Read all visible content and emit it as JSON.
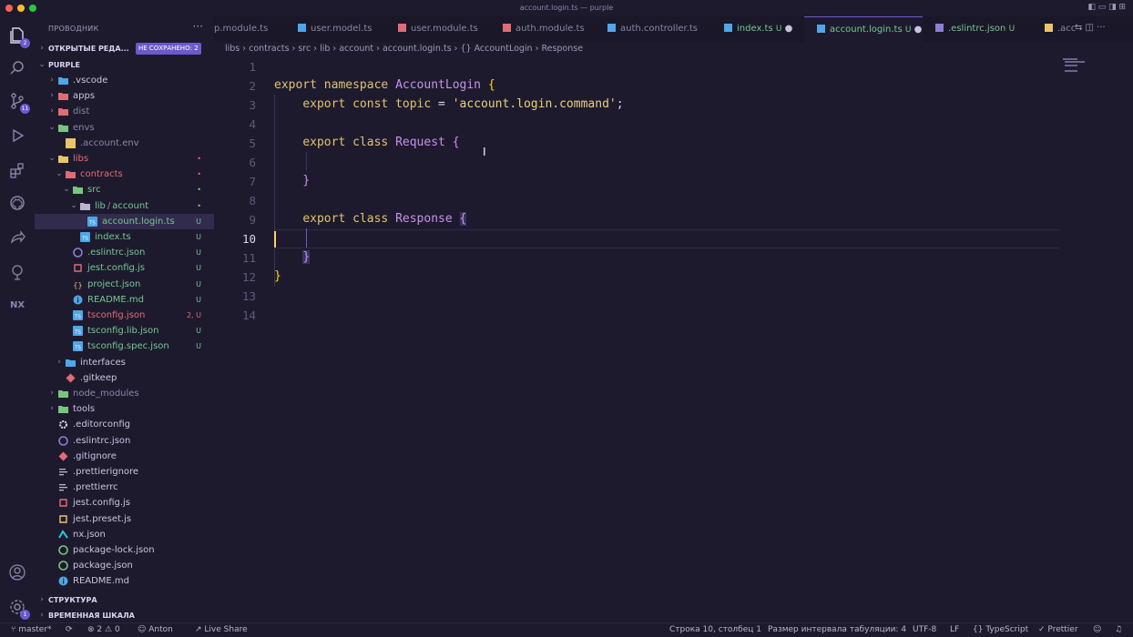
{
  "window": {
    "title": "account.login.ts — purple"
  },
  "colors": {
    "background": "#1e1a2e",
    "accent": "#6b5acd",
    "untracked": "#73c991",
    "error": "#e06c75",
    "keyword": "#e0c46c",
    "type": "#c792ea",
    "string": "#e8d27a"
  },
  "activity": {
    "explorer_badge": "2",
    "scm_badge": "11",
    "accounts_badge": "1",
    "nx_label": "NX"
  },
  "sidebar": {
    "title": "ПРОВОДНИК",
    "open_editors": "ОТКРЫТЫЕ РЕДА...",
    "unsaved_badge": "НЕ СОХРАНЕНО: 2",
    "root": "PURPLE",
    "outline": "СТРУКТУРА",
    "timeline": "ВРЕМЕННАЯ ШКАЛА",
    "tree": [
      {
        "label": ".vscode",
        "status": ""
      },
      {
        "label": "apps",
        "status": ""
      },
      {
        "label": "dist",
        "status": ""
      },
      {
        "label": "envs",
        "status": ""
      },
      {
        "label": ".account.env",
        "status": ""
      },
      {
        "label": "libs",
        "status": "•"
      },
      {
        "label": "contracts",
        "status": "•"
      },
      {
        "label": "src",
        "status": "•"
      },
      {
        "label": "lib",
        "sep": "/",
        "label2": "account",
        "status": "•"
      },
      {
        "label": "account.login.ts",
        "status": "U"
      },
      {
        "label": "index.ts",
        "status": "U"
      },
      {
        "label": ".eslintrc.json",
        "status": "U"
      },
      {
        "label": "jest.config.js",
        "status": "U"
      },
      {
        "label": "project.json",
        "status": "U"
      },
      {
        "label": "README.md",
        "status": "U"
      },
      {
        "label": "tsconfig.json",
        "status": "2, U"
      },
      {
        "label": "tsconfig.lib.json",
        "status": "U"
      },
      {
        "label": "tsconfig.spec.json",
        "status": "U"
      },
      {
        "label": "interfaces",
        "status": ""
      },
      {
        "label": ".gitkeep",
        "status": ""
      },
      {
        "label": "node_modules",
        "status": ""
      },
      {
        "label": "tools",
        "status": ""
      },
      {
        "label": ".editorconfig",
        "status": ""
      },
      {
        "label": ".eslintrc.json",
        "status": ""
      },
      {
        "label": ".gitignore",
        "status": ""
      },
      {
        "label": ".prettierignore",
        "status": ""
      },
      {
        "label": ".prettierrc",
        "status": ""
      },
      {
        "label": "jest.config.js",
        "status": ""
      },
      {
        "label": "jest.preset.js",
        "status": ""
      },
      {
        "label": "nx.json",
        "status": ""
      },
      {
        "label": "package-lock.json",
        "status": ""
      },
      {
        "label": "package.json",
        "status": ""
      },
      {
        "label": "README.md",
        "status": ""
      }
    ]
  },
  "tabs": [
    {
      "label": "p.module.ts",
      "status": ""
    },
    {
      "label": "user.model.ts",
      "status": ""
    },
    {
      "label": "user.module.ts",
      "status": ""
    },
    {
      "label": "auth.module.ts",
      "status": ""
    },
    {
      "label": "auth.controller.ts",
      "status": ""
    },
    {
      "label": "index.ts",
      "status": "U"
    },
    {
      "label": "account.login.ts",
      "status": "U"
    },
    {
      "label": ".eslintrc.json",
      "status": "U"
    },
    {
      "label": ".acc",
      "status": ""
    }
  ],
  "tab_icon_ts": "TS",
  "breadcrumb": [
    "libs",
    "contracts",
    "src",
    "lib",
    "account",
    "account.login.ts",
    "{} AccountLogin",
    "Response"
  ],
  "editor": {
    "line_numbers": [
      "1",
      "2",
      "3",
      "4",
      "5",
      "6",
      "7",
      "8",
      "9",
      "10",
      "11",
      "12",
      "13",
      "14"
    ],
    "tokens": {
      "export": "export",
      "namespace": "namespace",
      "AccountLogin": "AccountLogin",
      "const": "const",
      "topic": "topic",
      "eq": " = ",
      "str": "'account.login.command'",
      "semi": ";",
      "class": "class",
      "Request": "Request",
      "Response": "Response",
      "open": "{",
      "close": "}"
    }
  },
  "status": {
    "branch": "master*",
    "errors": "2",
    "warnings": "0",
    "user": "Anton",
    "live_share": "Live Share",
    "position": "Строка 10, столбец 1",
    "indent": "Размер интервала табуляции: 4",
    "encoding": "UTF-8",
    "eol": "LF",
    "language": "TypeScript",
    "formatter": "Prettier"
  }
}
